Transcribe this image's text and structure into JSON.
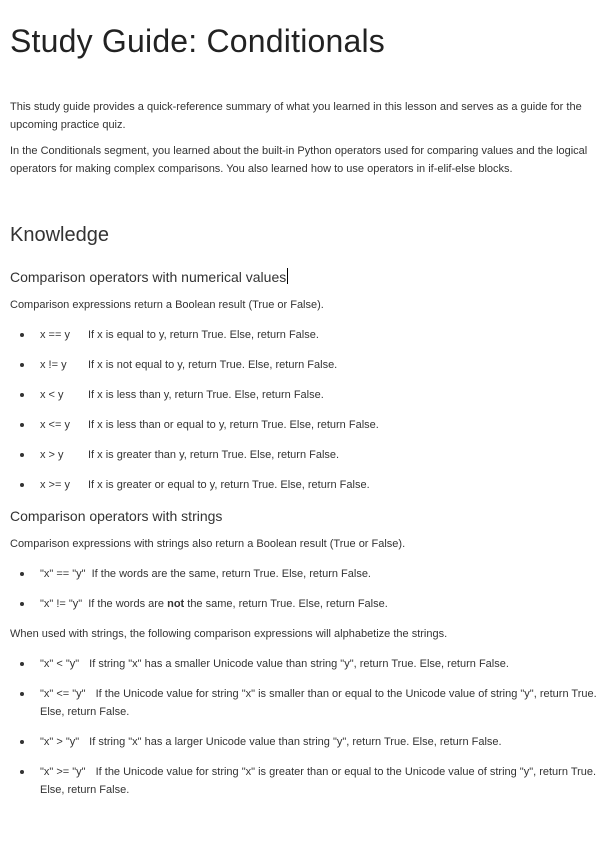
{
  "title": "Study Guide: Conditionals",
  "intro": [
    "This study guide provides a quick-reference summary of what you learned in this lesson and serves as a guide for the upcoming practice quiz.",
    "In the Conditionals segment, you learned about the built-in Python operators used for comparing values and the logical operators for making complex comparisons. You also learned how to use operators in if-elif-else blocks."
  ],
  "knowledge_heading": "Knowledge",
  "numeric": {
    "heading": "Comparison operators with numerical values",
    "lead": "Comparison expressions return a Boolean result (True or False).",
    "items": [
      {
        "code": "x == y",
        "desc": "If x is equal to y, return True. Else, return False."
      },
      {
        "code": "x != y",
        "desc": "If x is not equal to y, return True. Else, return False."
      },
      {
        "code": "x < y",
        "desc": "If x is less than y, return True. Else, return False."
      },
      {
        "code": "x <= y",
        "desc": "If x is less than or equal to y, return True. Else, return False."
      },
      {
        "code": "x > y",
        "desc": "If x is greater than y, return True. Else, return False."
      },
      {
        "code": "x >= y",
        "desc": "If x is greater or equal to y, return True. Else, return False."
      }
    ]
  },
  "strings": {
    "heading": "Comparison operators with strings",
    "lead": "Comparison expressions with strings also return a Boolean result (True or False).",
    "eq": {
      "code": "\"x\" == \"y\"",
      "desc": "If the words are the same, return True. Else, return False."
    },
    "neq": {
      "code": "\"x\" != \"y\"",
      "desc_pre": "If the words are ",
      "desc_bold": "not",
      "desc_post": " the same, return True. Else, return False."
    },
    "alpha_lead": "When used with strings, the following comparison expressions will alphabetize the strings.",
    "alpha_items": [
      {
        "code": "\"x\" < \"y\"",
        "desc": "If string \"x\"  has a smaller Unicode value than string \"y\", return True.  Else, return False."
      },
      {
        "code": "\"x\" <= \"y\"",
        "desc": "If the Unicode value for string \"x\" is smaller than or equal to the Unicode value of string \"y\", return True. Else, return False."
      },
      {
        "code": "\"x\" > \"y\"",
        "desc": "If string \"x\" has a larger Unicode value than string \"y\", return True. Else, return False."
      },
      {
        "code": "\"x\" >= \"y\"",
        "desc": "If the Unicode value for string \"x\" is greater than or equal to the Unicode value of string \"y\", return True. Else, return False."
      }
    ]
  }
}
